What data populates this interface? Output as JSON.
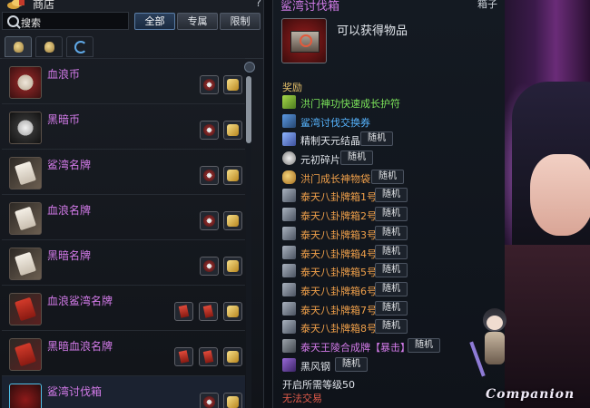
{
  "shop": {
    "title": "商店",
    "help": "?",
    "search_label": "搜索",
    "filters": [
      "全部",
      "专属",
      "限制"
    ],
    "active_filter": "全部",
    "tabs": [
      "bag-icon",
      "pouch-icon",
      "refresh-icon"
    ],
    "items": [
      {
        "name": "血浪币",
        "icon": "red-coin-icon",
        "costs": [
          "coin",
          "gold"
        ]
      },
      {
        "name": "黑暗币",
        "icon": "dark-coin-icon",
        "costs": [
          "coin",
          "gold"
        ]
      },
      {
        "name": "鲨湾名牌",
        "icon": "white-plate-icon",
        "costs": [
          "coin",
          "gold"
        ]
      },
      {
        "name": "血浪名牌",
        "icon": "white-plate-icon",
        "costs": [
          "coin",
          "gold"
        ]
      },
      {
        "name": "黑暗名牌",
        "icon": "white-plate-icon",
        "costs": [
          "coin",
          "gold"
        ]
      },
      {
        "name": "血浪鲨湾名牌",
        "icon": "red-plate-icon",
        "costs": [
          "red",
          "red",
          "gold"
        ]
      },
      {
        "name": "黑暗血浪名牌",
        "icon": "red-plate-icon",
        "costs": [
          "red",
          "red",
          "gold"
        ]
      },
      {
        "name": "鲨湾讨伐箱",
        "icon": "chest-icon",
        "costs": [
          "coin",
          "gold"
        ]
      }
    ]
  },
  "tooltip": {
    "title": "鲨湾讨伐箱",
    "type": "箱子",
    "description": "可以获得物品",
    "section": "奖励",
    "random_tag": "随机",
    "rewards": [
      {
        "name": "洪门神功快速成长护符",
        "color": "green",
        "icon": "jade",
        "random": false
      },
      {
        "name": "鲨湾讨伐交换券",
        "color": "blue",
        "icon": "ticket",
        "random": false
      },
      {
        "name": "精制天元结晶",
        "color": "white",
        "icon": "crystal",
        "random": true
      },
      {
        "name": "元初碎片",
        "color": "white",
        "icon": "frag",
        "random": true
      },
      {
        "name": "洪门成长神物袋",
        "color": "orange",
        "icon": "bag",
        "random": true
      },
      {
        "name": "泰天八卦牌箱1号",
        "color": "orange",
        "icon": "box",
        "random": true
      },
      {
        "name": "泰天八卦牌箱2号",
        "color": "orange",
        "icon": "box",
        "random": true
      },
      {
        "name": "泰天八卦牌箱3号",
        "color": "orange",
        "icon": "box",
        "random": true
      },
      {
        "name": "泰天八卦牌箱4号",
        "color": "orange",
        "icon": "box",
        "random": true
      },
      {
        "name": "泰天八卦牌箱5号",
        "color": "orange",
        "icon": "box",
        "random": true
      },
      {
        "name": "泰天八卦牌箱6号",
        "color": "orange",
        "icon": "box",
        "random": true
      },
      {
        "name": "泰天八卦牌箱7号",
        "color": "orange",
        "icon": "box",
        "random": true
      },
      {
        "name": "泰天八卦牌箱8号",
        "color": "orange",
        "icon": "box",
        "random": true
      },
      {
        "name": "泰天王陵合成牌【暴击】",
        "color": "purple",
        "icon": "plate",
        "random": true
      },
      {
        "name": "黑风钢",
        "color": "white",
        "icon": "steel",
        "random": true
      }
    ],
    "required_level": "开启所需等级50",
    "trade_note": "无法交易"
  },
  "companion": {
    "label": "Companion"
  },
  "colors": {
    "item_name": "#d27ae8",
    "warning": "#e05a4a",
    "section": "#e6c16a"
  }
}
